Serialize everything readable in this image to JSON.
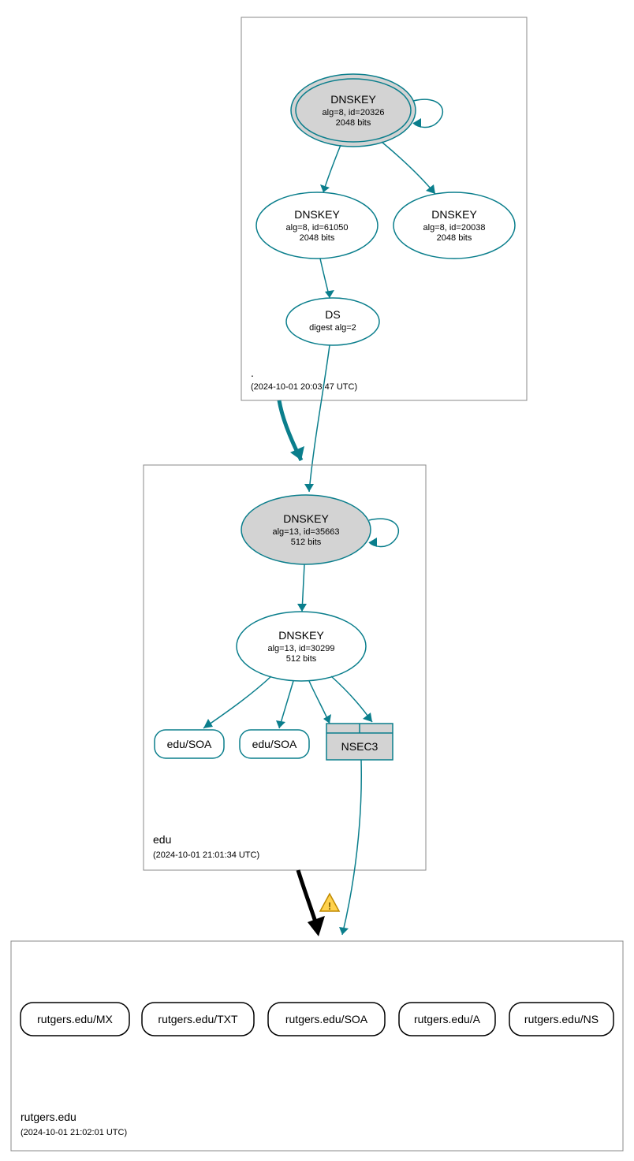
{
  "zones": {
    "root": {
      "label": ".",
      "timestamp": "(2024-10-01 20:03:47 UTC)",
      "ksk": {
        "title": "DNSKEY",
        "line1": "alg=8, id=20326",
        "line2": "2048 bits"
      },
      "zsk": {
        "title": "DNSKEY",
        "line1": "alg=8, id=61050",
        "line2": "2048 bits"
      },
      "extra_key": {
        "title": "DNSKEY",
        "line1": "alg=8, id=20038",
        "line2": "2048 bits"
      },
      "ds": {
        "title": "DS",
        "line1": "digest alg=2"
      }
    },
    "edu": {
      "label": "edu",
      "timestamp": "(2024-10-01 21:01:34 UTC)",
      "ksk": {
        "title": "DNSKEY",
        "line1": "alg=13, id=35663",
        "line2": "512 bits"
      },
      "zsk": {
        "title": "DNSKEY",
        "line1": "alg=13, id=30299",
        "line2": "512 bits"
      },
      "rr1": "edu/SOA",
      "rr2": "edu/SOA",
      "nsec3": "NSEC3"
    },
    "target": {
      "label": "rutgers.edu",
      "timestamp": "(2024-10-01 21:02:01 UTC)",
      "records": [
        "rutgers.edu/MX",
        "rutgers.edu/TXT",
        "rutgers.edu/SOA",
        "rutgers.edu/A",
        "rutgers.edu/NS"
      ]
    }
  }
}
